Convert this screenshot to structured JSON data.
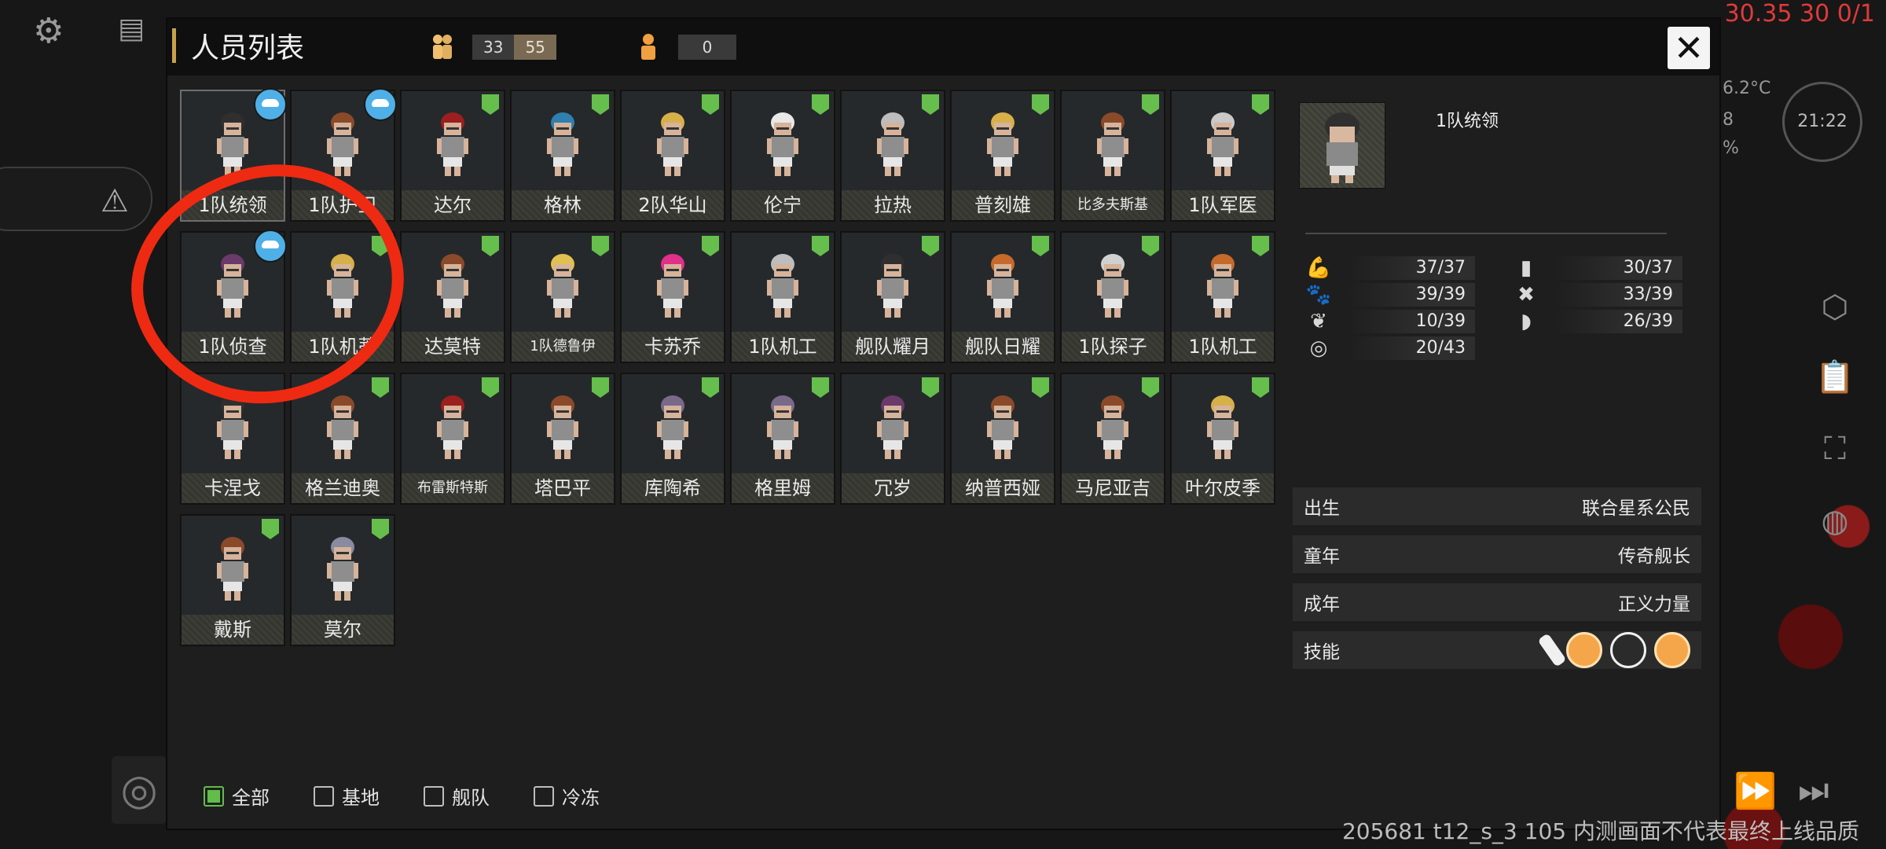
{
  "hud": {
    "top_right_text": "30.35 30 0/1",
    "temperature": "6.2°C",
    "side_text_1": "8",
    "side_text_2": "%",
    "clock": "21:22",
    "footer": "205681 t12_s_3 105  内测画面不代表最终上线品质"
  },
  "panel": {
    "title": "人员列表",
    "population": {
      "group1_a": "33",
      "group1_b": "55",
      "group2": "0"
    },
    "close_label": "✕"
  },
  "crew": [
    {
      "name": "1队统领",
      "badge": "blue",
      "hair": "#2f2f2f",
      "selected": true
    },
    {
      "name": "1队护卫",
      "badge": "blue",
      "hair": "#8a4a2a"
    },
    {
      "name": "达尔",
      "badge": "green",
      "hair": "#9b1f1f"
    },
    {
      "name": "格林",
      "badge": "green",
      "hair": "#2f7fb0"
    },
    {
      "name": "2队华山",
      "badge": "green",
      "hair": "#d8b04a"
    },
    {
      "name": "伦宁",
      "badge": "green",
      "hair": "#e8e8e8"
    },
    {
      "name": "拉热",
      "badge": "green",
      "hair": "#bdbdbd"
    },
    {
      "name": "普刻雄",
      "badge": "green",
      "hair": "#d8b04a"
    },
    {
      "name": "比多夫斯基",
      "badge": "green",
      "hair": "#8a4a2a",
      "small": true
    },
    {
      "name": "1队军医",
      "badge": "green",
      "hair": "#c9c9c9"
    },
    {
      "name": "1队侦查",
      "badge": "blue",
      "hair": "#6a3a6a"
    },
    {
      "name": "1队机蒂",
      "badge": "green",
      "hair": "#d8b04a"
    },
    {
      "name": "达莫特",
      "badge": "green",
      "hair": "#8a4a2a"
    },
    {
      "name": "1队德鲁伊",
      "badge": "green",
      "hair": "#e0c050",
      "small": true
    },
    {
      "name": "卡苏乔",
      "badge": "green",
      "hair": "#e0308a"
    },
    {
      "name": "1队机工",
      "badge": "green",
      "hair": "#bdbdbd"
    },
    {
      "name": "舰队耀月",
      "badge": "green",
      "hair": "#2f2f2f"
    },
    {
      "name": "舰队日耀",
      "badge": "green",
      "hair": "#c56a2a"
    },
    {
      "name": "1队探子",
      "badge": "green",
      "hair": "#d0d0d0"
    },
    {
      "name": "1队机工",
      "badge": "green",
      "hair": "#c56a2a"
    },
    {
      "name": "卡涅戈",
      "badge": "none",
      "hair": "#2f2f2f"
    },
    {
      "name": "格兰迪奥",
      "badge": "green",
      "hair": "#8a4a2a"
    },
    {
      "name": "布雷斯特斯",
      "badge": "green",
      "hair": "#9b1f1f",
      "small": true
    },
    {
      "name": "塔巴平",
      "badge": "green",
      "hair": "#8a4a2a"
    },
    {
      "name": "库陶希",
      "badge": "green",
      "hair": "#7a6a8a"
    },
    {
      "name": "格里姆",
      "badge": "green",
      "hair": "#7a6a8a"
    },
    {
      "name": "冗岁",
      "badge": "green",
      "hair": "#6a3a6a"
    },
    {
      "name": "纳普西娅",
      "badge": "green",
      "hair": "#8a4a2a"
    },
    {
      "name": "马尼亚吉",
      "badge": "green",
      "hair": "#8a4a2a"
    },
    {
      "name": "叶尔皮季",
      "badge": "green",
      "hair": "#d8b04a"
    },
    {
      "name": "戴斯",
      "badge": "green",
      "hair": "#8a4a2a"
    },
    {
      "name": "莫尔",
      "badge": "green",
      "hair": "#8a8aa0"
    }
  ],
  "filters": [
    {
      "label": "全部",
      "checked": true
    },
    {
      "label": "基地",
      "checked": false
    },
    {
      "label": "舰队",
      "checked": false
    },
    {
      "label": "冷冻",
      "checked": false
    }
  ],
  "detail": {
    "leader_title": "1队统领",
    "stats": [
      {
        "icon": "strength-icon",
        "glyph": "💪",
        "value": "37/37"
      },
      {
        "icon": "book-icon",
        "glyph": "▮",
        "value": "30/37"
      },
      {
        "icon": "paw-icon",
        "glyph": "🐾",
        "value": "39/39"
      },
      {
        "icon": "tools-icon",
        "glyph": "✖",
        "value": "33/39"
      },
      {
        "icon": "leaf-icon",
        "glyph": "❦",
        "value": "10/39"
      },
      {
        "icon": "helmet-icon",
        "glyph": "◗",
        "value": "26/39"
      },
      {
        "icon": "target-icon",
        "glyph": "◎",
        "value": "20/43"
      }
    ],
    "info": [
      {
        "label": "出生",
        "value": "联合星系公民"
      },
      {
        "label": "童年",
        "value": "传奇舰长"
      },
      {
        "label": "成年",
        "value": "正义力量"
      },
      {
        "label": "技能",
        "value": ""
      }
    ]
  }
}
